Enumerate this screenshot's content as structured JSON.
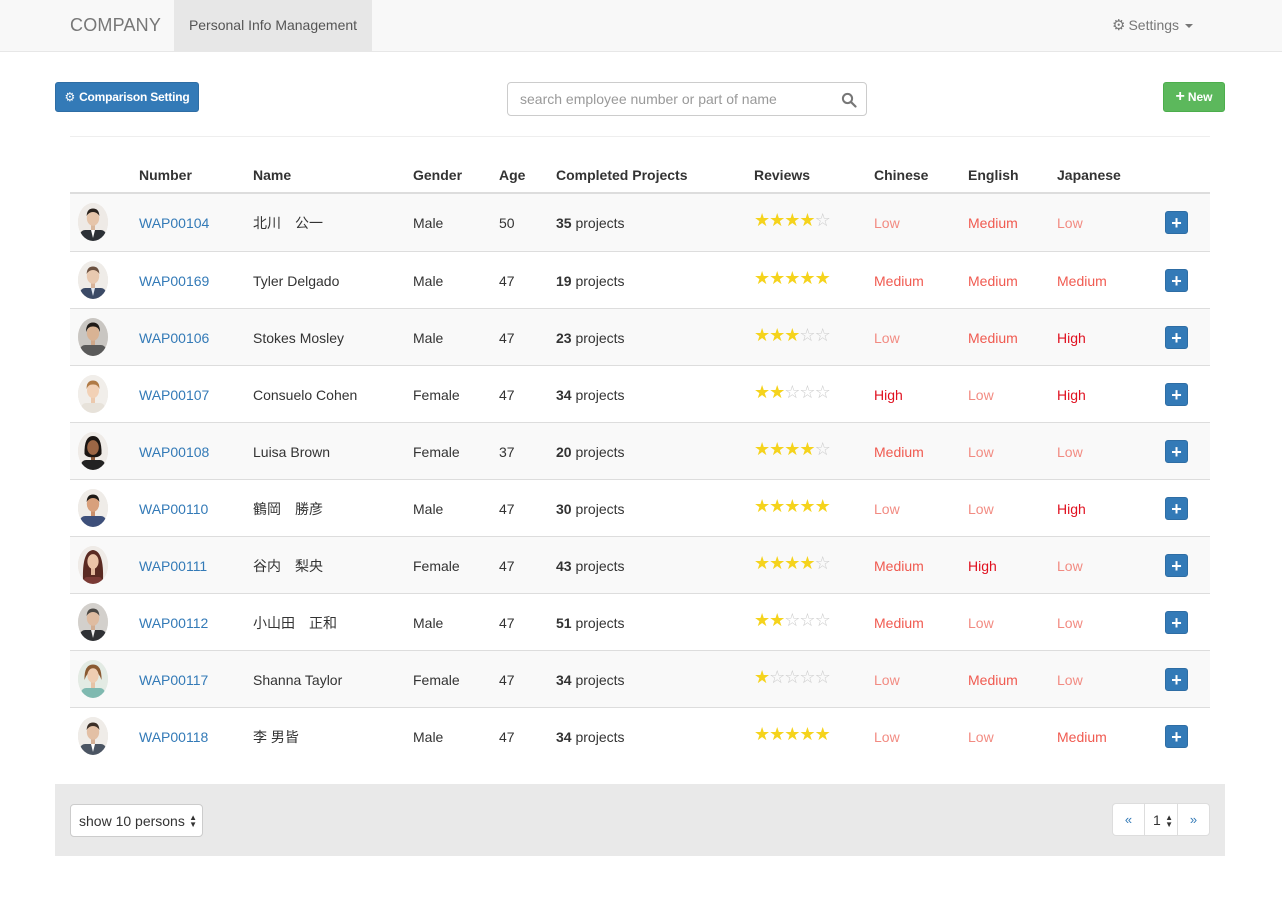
{
  "navbar": {
    "brand": "COMPANY",
    "active_tab": "Personal Info Management",
    "settings_label": "Settings"
  },
  "toolbar": {
    "comparison_label": "Comparison Setting",
    "search_placeholder": "search employee number or part of name",
    "new_label": "New"
  },
  "table": {
    "headers": {
      "number": "Number",
      "name": "Name",
      "gender": "Gender",
      "age": "Age",
      "projects": "Completed Projects",
      "reviews": "Reviews",
      "chinese": "Chinese",
      "english": "English",
      "japanese": "Japanese"
    },
    "projects_suffix": " projects",
    "rows": [
      {
        "number": "WAP00104",
        "name": "北川　公一",
        "gender": "Male",
        "age": "50",
        "projects": "35",
        "stars": 4,
        "chinese": "Low",
        "english": "Medium",
        "japanese": "Low"
      },
      {
        "number": "WAP00169",
        "name": "Tyler Delgado",
        "gender": "Male",
        "age": "47",
        "projects": "19",
        "stars": 5,
        "chinese": "Medium",
        "english": "Medium",
        "japanese": "Medium"
      },
      {
        "number": "WAP00106",
        "name": "Stokes Mosley",
        "gender": "Male",
        "age": "47",
        "projects": "23",
        "stars": 3,
        "chinese": "Low",
        "english": "Medium",
        "japanese": "High"
      },
      {
        "number": "WAP00107",
        "name": "Consuelo Cohen",
        "gender": "Female",
        "age": "47",
        "projects": "34",
        "stars": 2,
        "chinese": "High",
        "english": "Low",
        "japanese": "High"
      },
      {
        "number": "WAP00108",
        "name": "Luisa Brown",
        "gender": "Female",
        "age": "37",
        "projects": "20",
        "stars": 4,
        "chinese": "Medium",
        "english": "Low",
        "japanese": "Low"
      },
      {
        "number": "WAP00110",
        "name": "鶴岡　勝彦",
        "gender": "Male",
        "age": "47",
        "projects": "30",
        "stars": 5,
        "chinese": "Low",
        "english": "Low",
        "japanese": "High"
      },
      {
        "number": "WAP00111",
        "name": "谷内　梨央",
        "gender": "Female",
        "age": "47",
        "projects": "43",
        "stars": 4,
        "chinese": "Medium",
        "english": "High",
        "japanese": "Low"
      },
      {
        "number": "WAP00112",
        "name": "小山田　正和",
        "gender": "Male",
        "age": "47",
        "projects": "51",
        "stars": 2,
        "chinese": "Medium",
        "english": "Low",
        "japanese": "Low"
      },
      {
        "number": "WAP00117",
        "name": "Shanna Taylor",
        "gender": "Female",
        "age": "47",
        "projects": "34",
        "stars": 1,
        "chinese": "Low",
        "english": "Medium",
        "japanese": "Low"
      },
      {
        "number": "WAP00118",
        "name": "李 男皆",
        "gender": "Male",
        "age": "47",
        "projects": "34",
        "stars": 5,
        "chinese": "Low",
        "english": "Low",
        "japanese": "Medium"
      }
    ]
  },
  "footer": {
    "page_size_label": "show 10 persons",
    "prev_label": "«",
    "current_page": "1",
    "next_label": "»"
  },
  "colors": {
    "primary": "#337ab7",
    "success": "#5cb85c",
    "star": "#f5d31c",
    "level_low": "#f28b82",
    "level_medium": "#f05a50",
    "level_high": "#e0101f"
  }
}
